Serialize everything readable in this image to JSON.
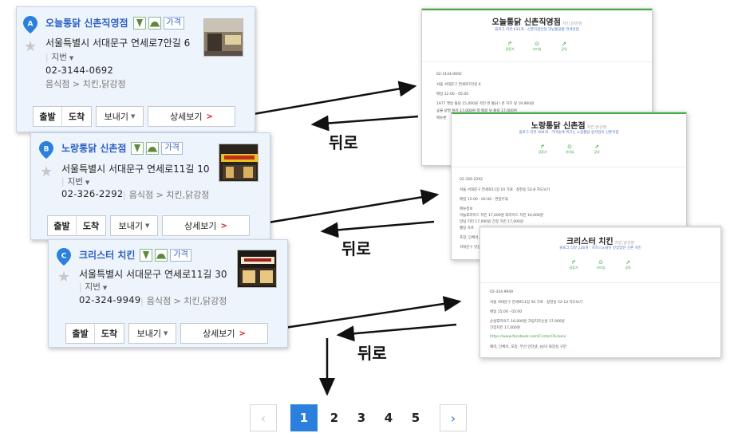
{
  "cards": [
    {
      "marker": "A",
      "name_plain": "오늘통닭 ",
      "name_bold": "신촌직영점",
      "price_label": "가격",
      "address": "서울특별시 서대문구 연세로7안길 6",
      "jibun_label": "지번",
      "phone": "02-3144-0692",
      "category": "음식점 > 치킨,닭강정",
      "buttons": {
        "depart": "출발",
        "arrive": "도착",
        "send": "보내기",
        "detail": "상세보기"
      }
    },
    {
      "marker": "B",
      "name_plain": "노랑통닭 ",
      "name_bold": "신촌점",
      "price_label": "가격",
      "address": "서울특별시 서대문구 연세로11길 10",
      "jibun_label": "지번",
      "phone": "02-326-2292",
      "category": "음식점 > 치킨,닭강정",
      "buttons": {
        "depart": "출발",
        "arrive": "도착",
        "send": "보내기",
        "detail": "상세보기"
      }
    },
    {
      "marker": "C",
      "name_plain": "크리스터 ",
      "name_bold": "치킨",
      "price_label": "가격",
      "address": "서울특별시 서대문구 연세로11길 30",
      "jibun_label": "지번",
      "phone": "02-324-9949",
      "category": "음식점 > 치킨,닭강정",
      "buttons": {
        "depart": "출발",
        "arrive": "도착",
        "send": "보내기",
        "detail": "상세보기"
      }
    }
  ],
  "panels": [
    {
      "title": "오늘통닭 신촌직영점",
      "subtitle": "치킨,닭강정",
      "meta": "블로그 리뷰 632개 · 신촌지점안점 맛남통닭출 연세일점",
      "actions": [
        "길찾기",
        "거리뷰",
        "공유"
      ],
      "lines": [
        "02-3144-0692",
        "서울 서대문구 연세로7안길 6",
        "매일 12:00 - 05:00",
        "1977 옛날 통닭    15,000원      치킨 반 통닭 / 콘 치즈 덮    19,900원",
        "숯불 닭발 튀김    17,000원      청 매콤 덮 통닭    17,000원",
        "메뉴판"
      ]
    },
    {
      "title": "노랑통닭 신촌점",
      "subtitle": "치킨,닭강정",
      "meta": "블로그 리뷰 404개 · 가마솥에 튀기는 노랑통닭 용지킴이 신촌지점",
      "actions": [
        "길찾기",
        "거리뷰",
        "공유"
      ],
      "lines": [
        "02-326-2292",
        "서울 서대문구 연세로11길 10   가로 · 창천동 52-8   지도보기",
        "매일 15:00 - 02:00 · 연중무휴",
        "메뉴정보",
        "마늘후라이드 치킨    17,000원      후라이드 치킨    16,000원",
        "양념 치킨    17,000원      간장 치킨    17,000원",
        "웰빙 하프",
        "포장, 단체석, 배달, 무선 인터넷",
        "서대문구 맛집"
      ]
    },
    {
      "title": "크리스터 치킨",
      "subtitle": "치킨,닭강정",
      "meta": "블로그 리뷰 226개 · 치즈스노윙이 맛있었던 신촌 치킨",
      "actions": [
        "길찾기",
        "거리뷰",
        "공유"
      ],
      "lines": [
        "02-324-9949",
        "서울 서대문구 연세로11길 30   가로 · 창천동 52-14   지도보기",
        "매일 15:00 - 02:00",
        "순살후라이드    16,000원      크림치즈순살    17,000원",
        "간장치킨    17,000원",
        "https://www.facebook.com/CristerChicken/",
        "예약, 단체석, 포장, 무선 인터넷, 남/녀 화장실 구분"
      ]
    }
  ],
  "back_label": "뒤로",
  "pagination": {
    "pages": [
      "1",
      "2",
      "3",
      "4",
      "5"
    ],
    "current": "1",
    "prev": "‹",
    "next": "›"
  },
  "colors": {
    "link": "#2b5fc4",
    "active_page": "#2a80dc",
    "accent_green": "#40b040",
    "detail_arrow": "#d02020"
  }
}
